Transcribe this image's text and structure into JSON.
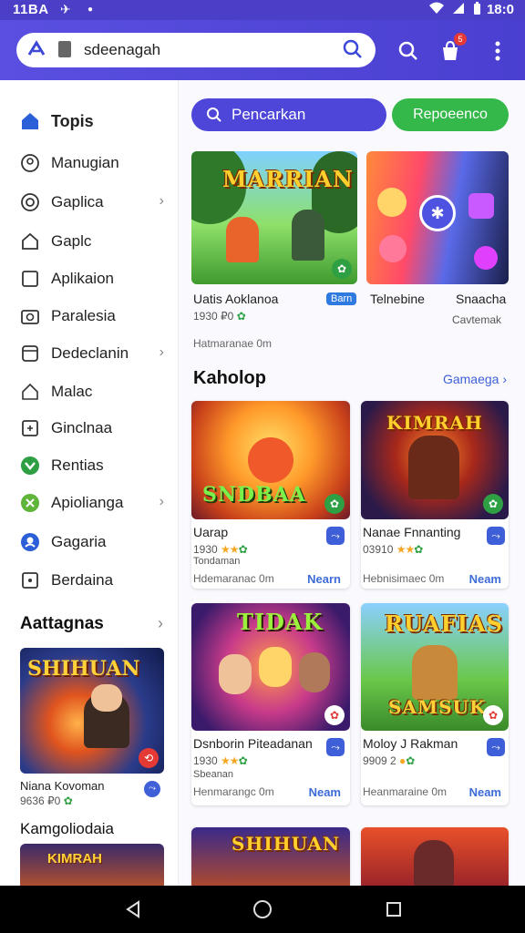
{
  "status_bar": {
    "time": "11BA",
    "clock_right": "18:0"
  },
  "header": {
    "search_value": "sdeenagah",
    "notification_count": "5"
  },
  "sidebar": {
    "items": [
      {
        "label": "Topis",
        "icon": "home-icon"
      },
      {
        "label": "Manugian",
        "icon": "location-icon"
      },
      {
        "label": "Gaplica",
        "icon": "target-icon"
      },
      {
        "label": "Gaplc",
        "icon": "house-icon"
      },
      {
        "label": "Aplikaion",
        "icon": "square-icon"
      },
      {
        "label": "Paralesia",
        "icon": "camera-icon"
      },
      {
        "label": "Dedeclanin",
        "icon": "window-icon"
      },
      {
        "label": "Malac",
        "icon": "house-outline-icon"
      },
      {
        "label": "Ginclnaa",
        "icon": "puzzle-icon"
      },
      {
        "label": "Rentias",
        "icon": "shield-green-icon"
      },
      {
        "label": "Apiolianga",
        "icon": "star-green-icon"
      },
      {
        "label": "Gagaria",
        "icon": "user-blue-icon"
      },
      {
        "label": "Berdaina",
        "icon": "dot-square-icon"
      }
    ],
    "section1": "Aattagnas",
    "card1": {
      "title": "Niana Kovoman",
      "meta": "9636 ₽0"
    },
    "section2": "Kamgoliodaia"
  },
  "main": {
    "search_button": "Pencarkan",
    "green_button": "Repoeenco",
    "top_left": {
      "art_title": "MARRIAN",
      "title": "Uatis Aoklanoa",
      "tag": "Barn",
      "meta": "1930 ₽0",
      "foot": "Hatmaranae 0m"
    },
    "top_right": {
      "title1": "Telnebine",
      "title2": "Snaacha",
      "sub": "Cavtemak"
    },
    "section_title": "Kaholop",
    "section_link": "Gamaega ›",
    "cards": [
      {
        "art_title": "SNDBAA",
        "title": "Uarap",
        "meta": "1930",
        "sub": "Tondaman",
        "foot": "Hdemaranac 0m",
        "link": "Nearn"
      },
      {
        "art_title": "KIMRAH",
        "title": "Nanae Fnnanting",
        "meta": "03910",
        "sub": "",
        "foot": "Hebnisimaec 0m",
        "link": "Neam"
      },
      {
        "art_title": "TIDAK",
        "title": "Dsnborin Piteadanan",
        "meta": "1930",
        "sub": "Sbeanan",
        "foot": "Henmarangc 0m",
        "link": "Neam"
      },
      {
        "art_title": "RUAFIAS",
        "title": "Moloy J Rakman",
        "meta": "9909 2",
        "sub": "",
        "foot": "Heanmaraine 0m",
        "link": "Neam"
      },
      {
        "art_title": "SHIHUAN",
        "title": "",
        "meta": "",
        "sub": "",
        "foot": "",
        "link": ""
      },
      {
        "art_title": "",
        "title": "",
        "meta": "",
        "sub": "",
        "foot": "",
        "link": ""
      }
    ]
  },
  "colors": {
    "header": "#4b3fc7",
    "search_button": "#4d46d8",
    "green_button": "#34b84a",
    "link": "#3d6bd8"
  }
}
